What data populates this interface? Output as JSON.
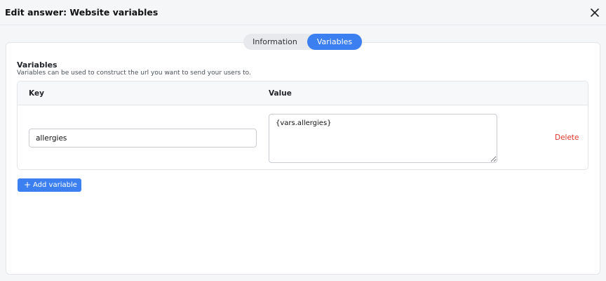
{
  "header": {
    "title": "Edit answer: Website variables",
    "close_icon": "close-icon"
  },
  "tabs": [
    {
      "label": "Information",
      "active": false
    },
    {
      "label": "Variables",
      "active": true
    }
  ],
  "section": {
    "title": "Variables",
    "description": "Variables can be used to construct the url you want to send your users to."
  },
  "table": {
    "columns": [
      "Key",
      "Value"
    ],
    "rows": [
      {
        "key": "allergies",
        "value": "{vars.allergies}",
        "action": "Delete"
      }
    ]
  },
  "add_button": {
    "icon": "plus",
    "label": "Add variable"
  },
  "colors": {
    "accent": "#3b7ff0",
    "danger": "#e0352b"
  }
}
